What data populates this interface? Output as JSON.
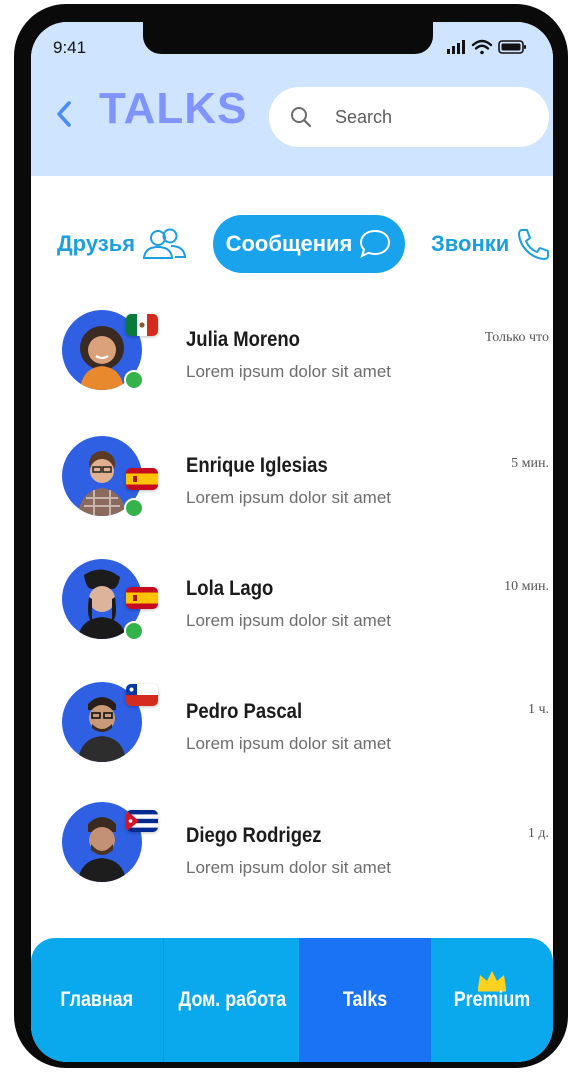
{
  "status_bar": {
    "time": "9:41"
  },
  "header": {
    "title": "TALKS",
    "search": {
      "placeholder": "Search",
      "value": ""
    }
  },
  "tabs": [
    {
      "label": "Друзья",
      "icon": "friends-icon",
      "active": false
    },
    {
      "label": "Сообщения",
      "icon": "chat-bubble-icon",
      "active": true
    },
    {
      "label": "Звонки",
      "icon": "phone-icon",
      "active": false
    }
  ],
  "chats": [
    {
      "name": "Julia Moreno",
      "preview": "Lorem ipsum dolor sit amet",
      "time": "Только что",
      "flag": "mexico",
      "online": true
    },
    {
      "name": "Enrique Iglesias",
      "preview": "Lorem ipsum dolor sit amet",
      "time": "5 мин.",
      "flag": "spain",
      "online": true
    },
    {
      "name": "Lola Lago",
      "preview": "Lorem ipsum dolor sit amet",
      "time": "10 мин.",
      "flag": "spain",
      "online": true
    },
    {
      "name": "Pedro Pascal",
      "preview": "Lorem ipsum dolor sit amet",
      "time": "1 ч.",
      "flag": "chile",
      "online": false
    },
    {
      "name": "Diego Rodrigez",
      "preview": "Lorem ipsum dolor sit amet",
      "time": "1 д.",
      "flag": "cuba",
      "online": false
    }
  ],
  "bottom_nav": [
    {
      "label": "Главная",
      "active": false
    },
    {
      "label": "Дом. работа",
      "active": false
    },
    {
      "label": "Talks",
      "active": true
    },
    {
      "label": "Premium",
      "active": false,
      "icon": "crown-icon"
    }
  ],
  "colors": {
    "header_bg": "#cfe4ff",
    "title": "#7f94ff",
    "accent": "#18a3ec",
    "nav_bg": "#0aa9ee",
    "nav_active": "#1a73f5",
    "avatar_bg": "#2f5fe3",
    "online": "#34b34a",
    "crown": "#ffd21f"
  }
}
